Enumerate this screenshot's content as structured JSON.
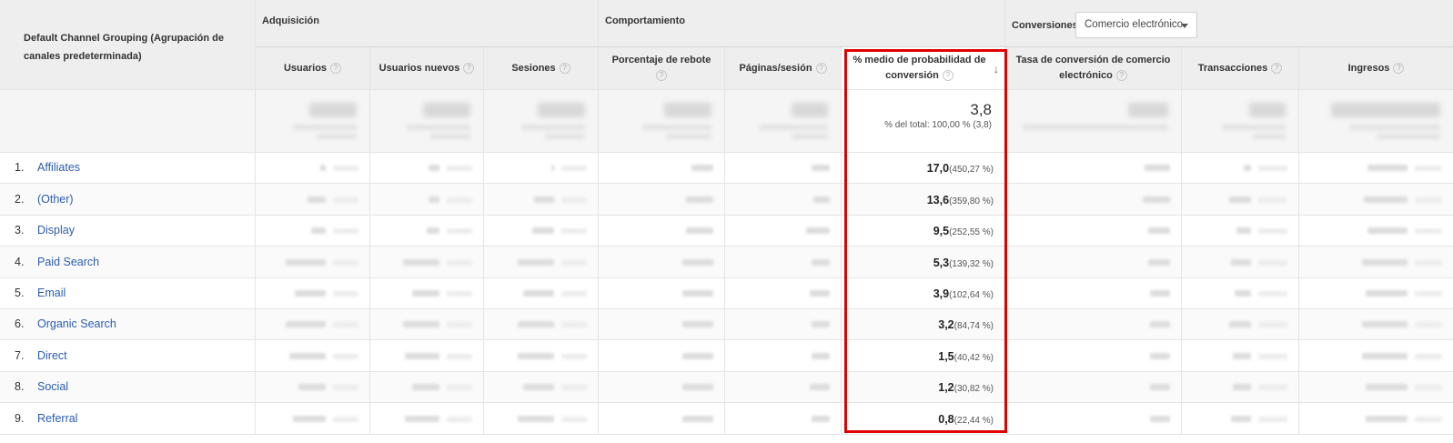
{
  "header": {
    "dimension_label": "Default Channel Grouping (Agrupación de canales predeterminada)",
    "groups": {
      "adquisicion": "Adquisición",
      "comportamiento": "Comportamiento",
      "conversiones": "Conversiones"
    },
    "conversion_select": "Comercio electrónico",
    "columns": {
      "usuarios": "Usuarios",
      "usuarios_nuevos": "Usuarios nuevos",
      "sesiones": "Sesiones",
      "porcentaje_rebote": "Porcentaje de rebote",
      "paginas_sesion": "Páginas/sesión",
      "conv_prob": "% medio de probabilidad de conversión",
      "tasa_conv": "Tasa de conversión de comercio electrónico",
      "transacciones": "Transacciones",
      "ingresos": "Ingresos"
    },
    "help_glyph": "?",
    "sort_glyph": "↓"
  },
  "totals": {
    "conv_prob_value": "3,8",
    "conv_prob_sub": "% del total: 100,00 % (3,8)"
  },
  "rows": [
    {
      "rank": "1.",
      "channel": "Affiliates",
      "conv_value": "17,0",
      "conv_pct": "(450,27 %)"
    },
    {
      "rank": "2.",
      "channel": "(Other)",
      "conv_value": "13,6",
      "conv_pct": "(359,80 %)"
    },
    {
      "rank": "3.",
      "channel": "Display",
      "conv_value": "9,5",
      "conv_pct": "(252,55 %)"
    },
    {
      "rank": "4.",
      "channel": "Paid Search",
      "conv_value": "5,3",
      "conv_pct": "(139,32 %)"
    },
    {
      "rank": "5.",
      "channel": "Email",
      "conv_value": "3,9",
      "conv_pct": "(102,64 %)"
    },
    {
      "rank": "6.",
      "channel": "Organic Search",
      "conv_value": "3,2",
      "conv_pct": "(84,74 %)"
    },
    {
      "rank": "7.",
      "channel": "Direct",
      "conv_value": "1,5",
      "conv_pct": "(40,42 %)"
    },
    {
      "rank": "8.",
      "channel": "Social",
      "conv_value": "1,2",
      "conv_pct": "(30,82 %)"
    },
    {
      "rank": "9.",
      "channel": "Referral",
      "conv_value": "0,8",
      "conv_pct": "(22,44 %)"
    }
  ],
  "colors": {
    "highlight_border": "#e00000",
    "link": "#2a5db0",
    "header_bg": "#eeeeee"
  }
}
